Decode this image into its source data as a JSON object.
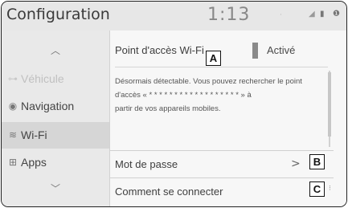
{
  "header": {
    "title": "Configuration",
    "clock": "1:13",
    "signal_icon": "signal-icon",
    "battery_icon": "battery-icon",
    "alert_icon": "alert-icon"
  },
  "sidebar": {
    "up_icon": "chevron-up-icon",
    "down_icon": "chevron-down-icon",
    "items": [
      {
        "label": "Véhicule",
        "icon": "car-icon",
        "state": "disabled"
      },
      {
        "label": "Navigation",
        "icon": "navigation-icon",
        "state": "normal"
      },
      {
        "label": "Wi-Fi",
        "icon": "wifi-icon",
        "state": "selected"
      },
      {
        "label": "Apps",
        "icon": "apps-icon",
        "state": "normal"
      }
    ]
  },
  "main": {
    "hotspot": {
      "label": "Point d'accès Wi-Fi",
      "toggle_value": "Activé"
    },
    "description_lines": [
      "Désormais détectable. Vous pouvez rechercher le point",
      "d'accès « * * * * * * * * * * * * * * * * * * » à",
      "partir de vos appareils mobiles."
    ],
    "password": {
      "label": "Mot de passe",
      "arrow": ">"
    },
    "connect": {
      "label": "Comment se connecter"
    }
  },
  "callouts": {
    "a": "A",
    "b": "B",
    "c": "C"
  }
}
